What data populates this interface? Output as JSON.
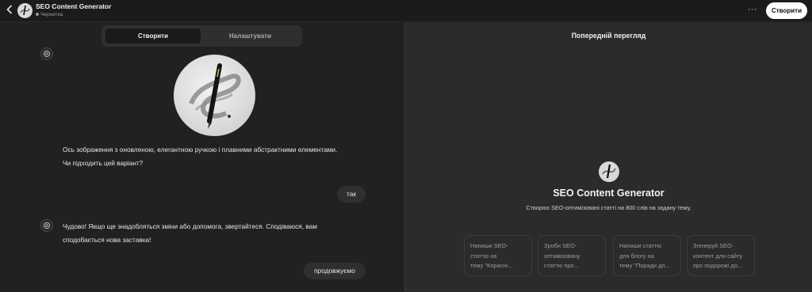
{
  "header": {
    "back_icon": "chevron-left-icon",
    "app_title": "SEO Content Generator",
    "status": "Чернетка",
    "more_label": "···",
    "create_button": "Створити"
  },
  "tabs": [
    {
      "label": "Створити",
      "active": true
    },
    {
      "label": "Налаштувати",
      "active": false
    }
  ],
  "chat": {
    "bot_icon": "openai-logo-icon",
    "message1_line1": "Ось зображення з оновленою, елегантною ручкою і плавними абстрактними елементами.",
    "message1_line2": "Чи підходить цей варіант?",
    "user_reply1": "так",
    "message2_line1": "Чудово! Якщо ще знадобляться зміни або допомога, звертайтеся. Сподіваюся, вам",
    "message2_line2": "сподобається нова заставка!",
    "user_reply2": "продовжуємо"
  },
  "preview": {
    "title": "Попередній перегляд",
    "gpt_name": "SEO Content Generator",
    "gpt_description": "Створює SEO-оптимізовані статті на 800 слів на задану тему.",
    "starters": [
      {
        "line1": "Напиши SEO-",
        "line2": "статтю на",
        "line3": "тему \"Корисні..."
      },
      {
        "line1": "Зроби SEO-",
        "line2": "оптимізовану",
        "line3": "статтю про..."
      },
      {
        "line1": "Напиши статтю",
        "line2": "для блогу на",
        "line3": "тему \"Поради дл..."
      },
      {
        "line1": "Згенеруй SEO-",
        "line2": "контент для сайту",
        "line3": "про подорожі до..."
      }
    ]
  },
  "colors": {
    "background": "#212121",
    "preview_background": "#2b2b2b",
    "accent_button": "#ffffff"
  }
}
